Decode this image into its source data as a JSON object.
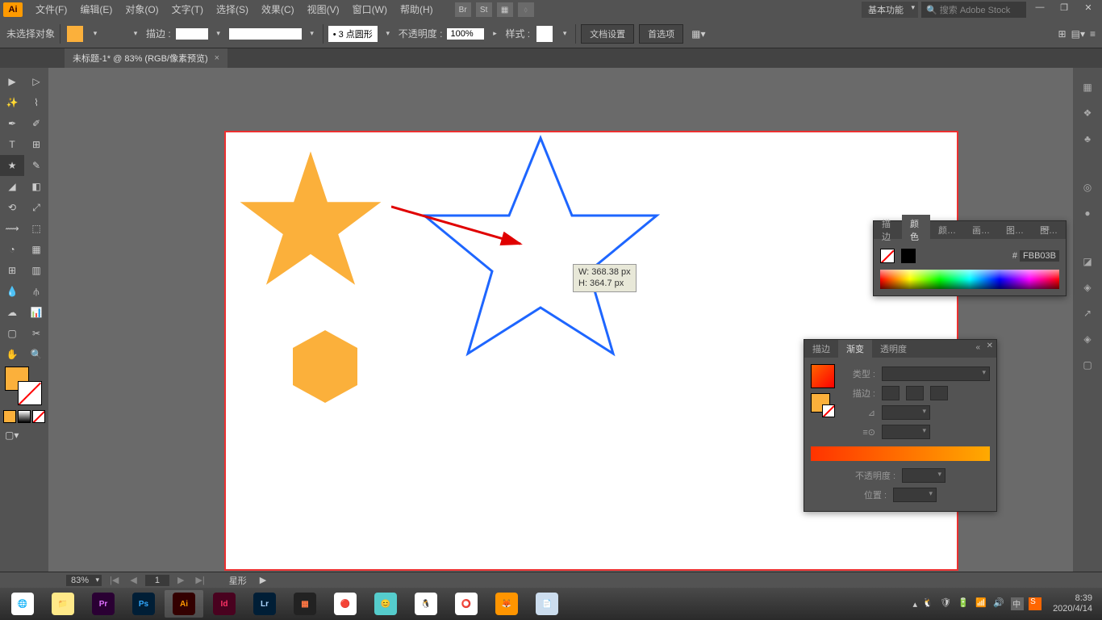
{
  "menubar": {
    "items": [
      "文件(F)",
      "编辑(E)",
      "对象(O)",
      "文字(T)",
      "选择(S)",
      "效果(C)",
      "视图(V)",
      "窗口(W)",
      "帮助(H)"
    ],
    "workspace": "基本功能",
    "search_placeholder": "搜索 Adobe Stock"
  },
  "controlbar": {
    "selection": "未选择对象",
    "stroke_label": "描边 :",
    "stroke_width": "",
    "brush_label": "3 点圆形",
    "opacity_label": "不透明度 :",
    "opacity_value": "100%",
    "style_label": "样式 :",
    "doc_setup": "文档设置",
    "prefs": "首选项",
    "fill_color": "#fbb03b"
  },
  "tab": {
    "title": "未标题-1* @ 83% (RGB/像素预览)"
  },
  "canvas": {
    "tooltip_w": "W: 368.38 px",
    "tooltip_h": "H: 364.7 px"
  },
  "color_panel": {
    "tabs": [
      "描边",
      "颜色",
      "颜…",
      "画…",
      "图…",
      "图…"
    ],
    "active_tab": 1,
    "hex_prefix": "#",
    "hex_value": "FBB03B"
  },
  "gradient_panel": {
    "tabs": [
      "描边",
      "渐变",
      "透明度"
    ],
    "active_tab": 1,
    "type_label": "类型 :",
    "stroke_label": "描边 :",
    "angle_label": "⊿",
    "ratio_label": "≡⊙",
    "opacity_label": "不透明度 :",
    "pos_label": "位置 :"
  },
  "statusbar": {
    "zoom": "83%",
    "page": "1",
    "tool": "星形"
  },
  "taskbar": {
    "apps": [
      {
        "name": "browser",
        "bg": "#fff",
        "txt": "🔵"
      },
      {
        "name": "explorer",
        "bg": "#ffe989",
        "txt": "📁"
      },
      {
        "name": "premiere",
        "bg": "#2a0033",
        "txt": "Pr"
      },
      {
        "name": "photoshop",
        "bg": "#001e36",
        "txt": "Ps"
      },
      {
        "name": "illustrator",
        "bg": "#330000",
        "txt": "Ai"
      },
      {
        "name": "indesign",
        "bg": "#49021f",
        "txt": "Id"
      },
      {
        "name": "lightroom",
        "bg": "#001e36",
        "txt": "Lr"
      },
      {
        "name": "app1",
        "bg": "#222",
        "txt": "▦"
      },
      {
        "name": "chrome2",
        "bg": "#fff",
        "txt": "🔴"
      },
      {
        "name": "app2",
        "bg": "#5cc",
        "txt": "😊"
      },
      {
        "name": "qq",
        "bg": "#fff",
        "txt": "🐧"
      },
      {
        "name": "chrome",
        "bg": "#fff",
        "txt": "⭕"
      },
      {
        "name": "firefox",
        "bg": "#ff9500",
        "txt": "🦊"
      },
      {
        "name": "notes",
        "bg": "#cde",
        "txt": "📄"
      }
    ],
    "time": "8:39",
    "date": "2020/4/14"
  }
}
